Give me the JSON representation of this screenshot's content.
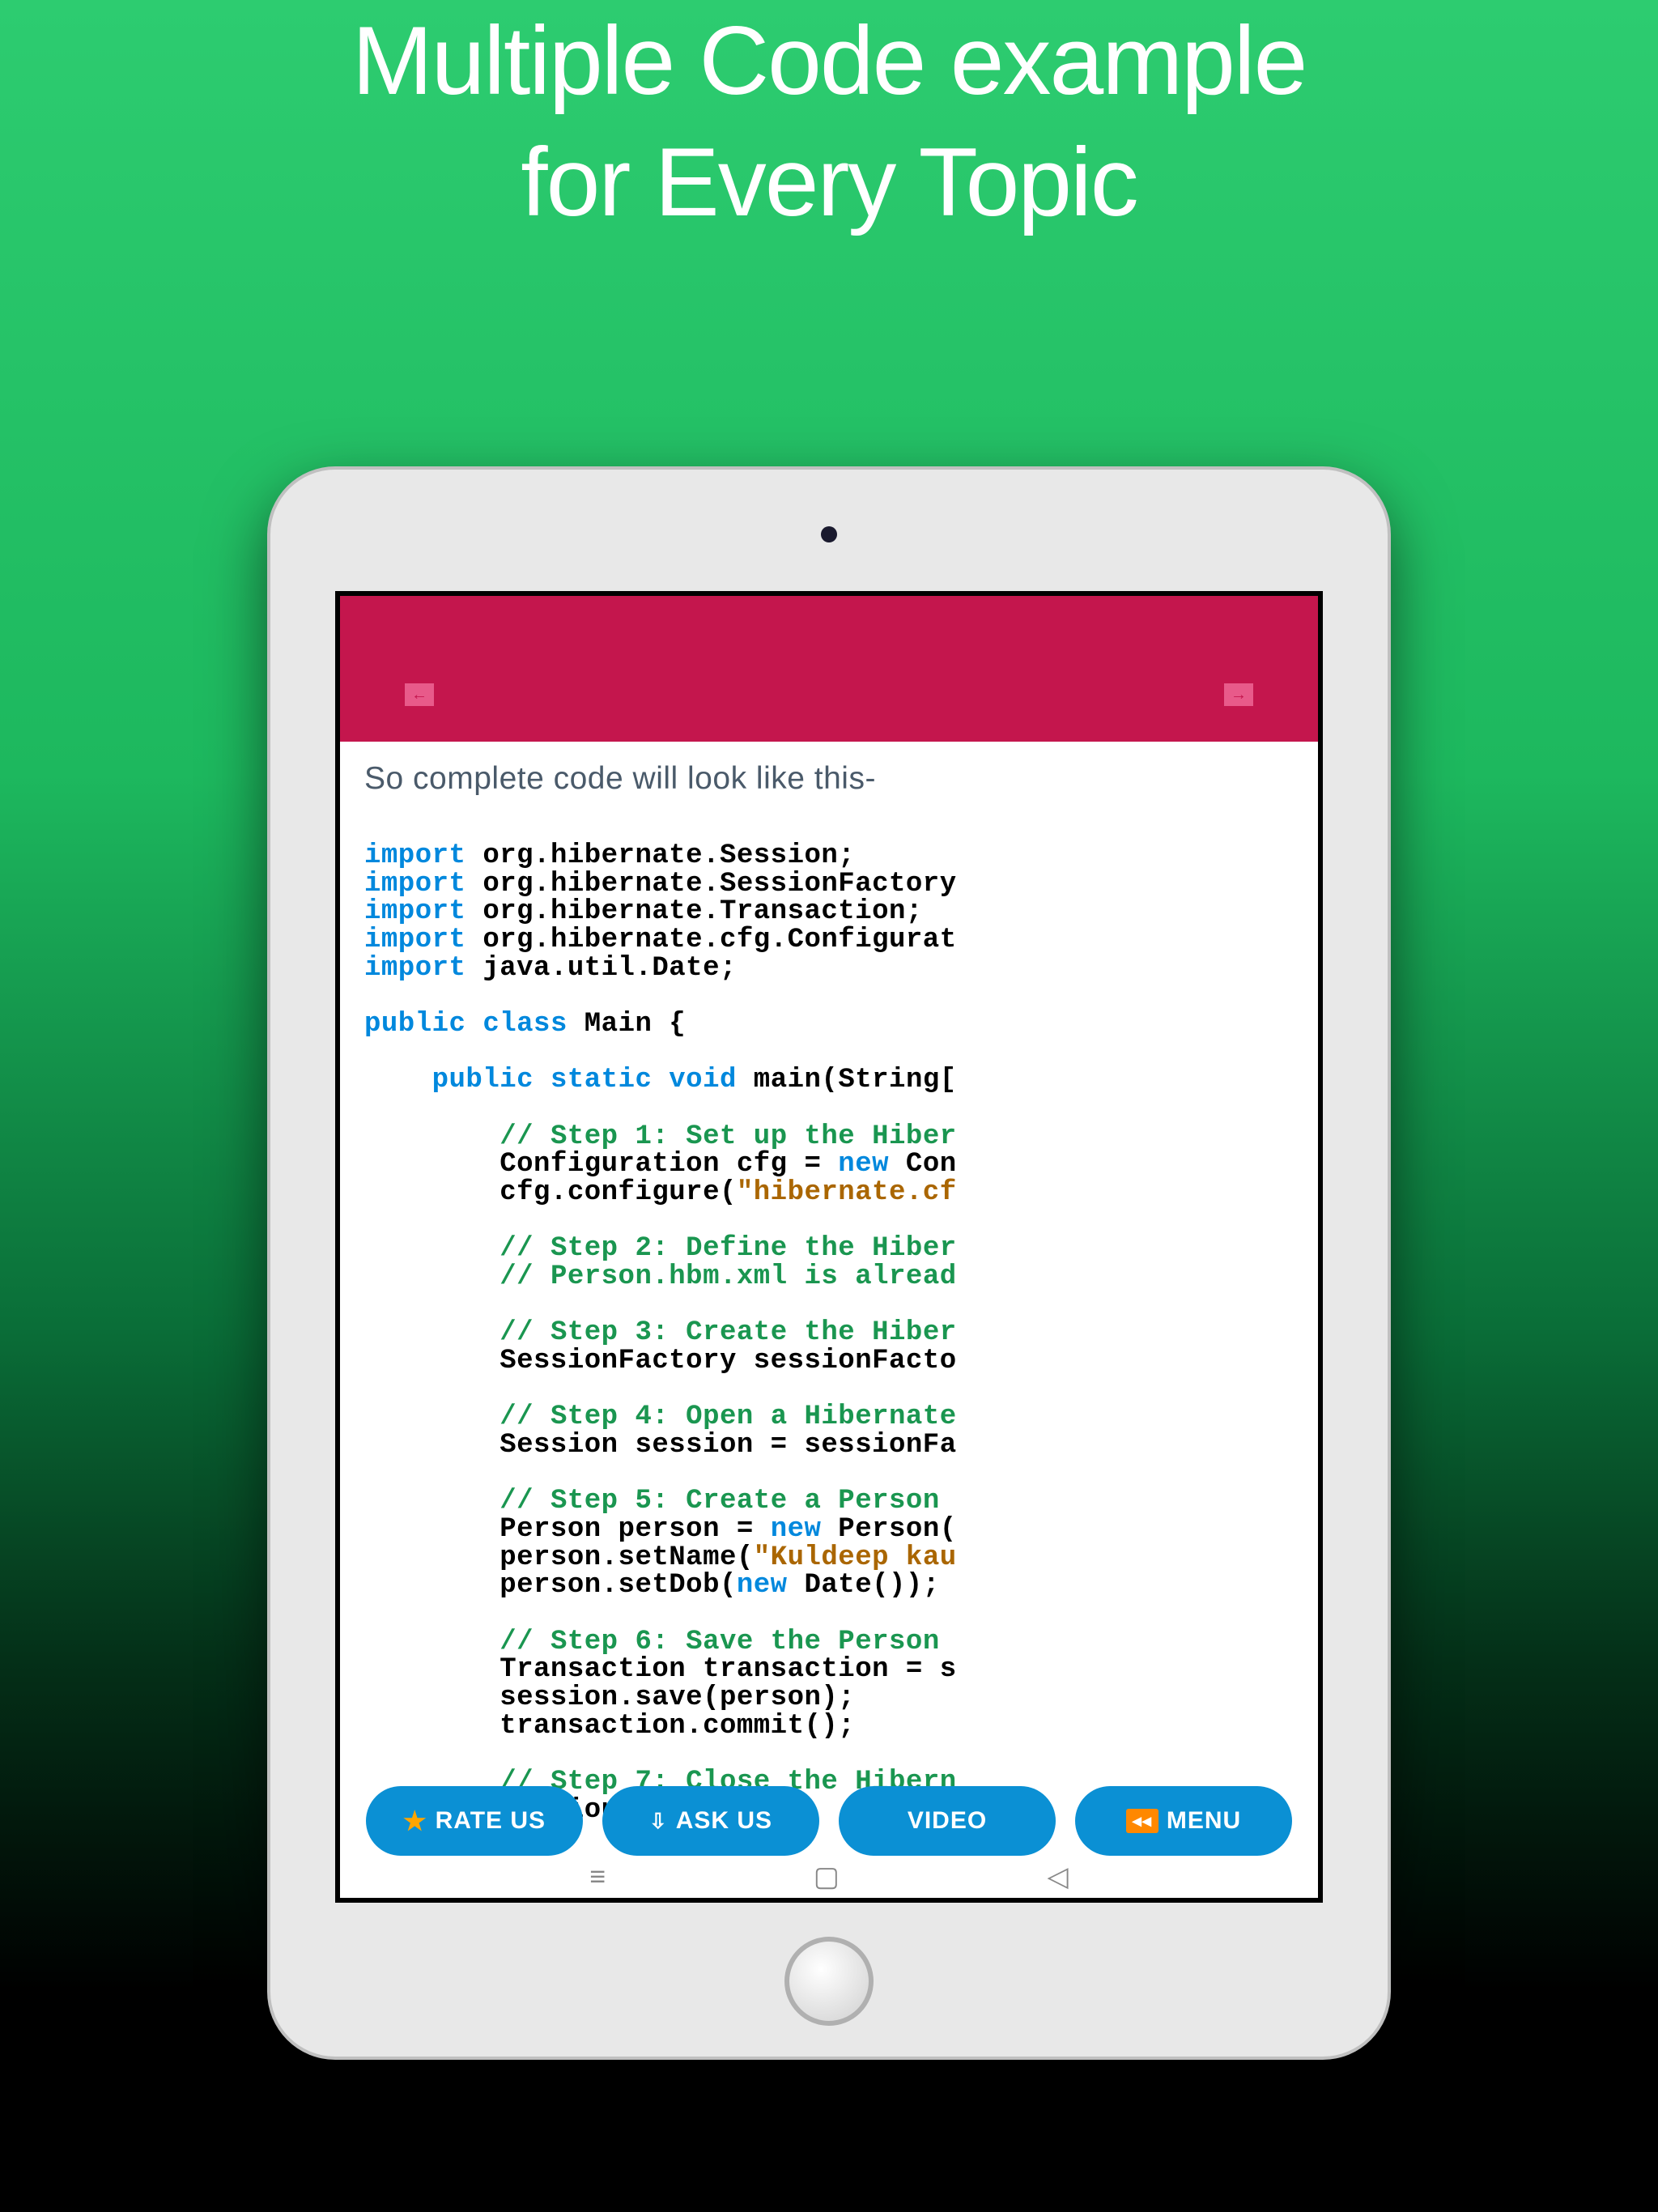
{
  "headline": {
    "line1": "Multiple Code example",
    "line2": "for Every Topic"
  },
  "intro": "So complete code will look like this-",
  "code": {
    "imports": [
      {
        "keyword": "import",
        "rest": " org.hibernate.Session;"
      },
      {
        "keyword": "import",
        "rest": " org.hibernate.SessionFactory"
      },
      {
        "keyword": "import",
        "rest": " org.hibernate.Transaction;"
      },
      {
        "keyword": "import",
        "rest": " org.hibernate.cfg.Configurat"
      },
      {
        "keyword": "import",
        "rest": " java.util.Date;"
      }
    ],
    "class_decl": {
      "kw1": "public",
      "kw2": "class",
      "name": " Main {"
    },
    "main_decl": {
      "kw1": "public",
      "kw2": "static",
      "kw3": "void",
      "rest": " main(String["
    },
    "body": [
      {
        "type": "comment",
        "text": "// Step 1: Set up the Hiber"
      },
      {
        "type": "mixed",
        "pre": "Configuration cfg = ",
        "kw": "new",
        "post": " Con"
      },
      {
        "type": "string_line",
        "pre": "cfg.configure(",
        "str": "\"hibernate.cf"
      },
      {
        "type": "blank"
      },
      {
        "type": "comment",
        "text": "// Step 2: Define the Hiber"
      },
      {
        "type": "comment",
        "text": "// Person.hbm.xml is alread"
      },
      {
        "type": "blank"
      },
      {
        "type": "comment",
        "text": "// Step 3: Create the Hiber"
      },
      {
        "type": "plain",
        "text": "SessionFactory sessionFacto"
      },
      {
        "type": "blank"
      },
      {
        "type": "comment",
        "text": "// Step 4: Open a Hibernate"
      },
      {
        "type": "plain",
        "text": "Session session = sessionFa"
      },
      {
        "type": "blank"
      },
      {
        "type": "comment",
        "text": "// Step 5: Create a Person "
      },
      {
        "type": "mixed",
        "pre": "Person person = ",
        "kw": "new",
        "post": " Person("
      },
      {
        "type": "string_line",
        "pre": "person.setName(",
        "str": "\"Kuldeep kau"
      },
      {
        "type": "mixed",
        "pre": "person.setDob(",
        "kw": "new",
        "post": " Date());"
      },
      {
        "type": "blank"
      },
      {
        "type": "comment",
        "text": "// Step 6: Save the Person "
      },
      {
        "type": "plain",
        "text": "Transaction transaction = s"
      },
      {
        "type": "plain",
        "text": "session.save(person);"
      },
      {
        "type": "plain",
        "text": "transaction.commit();"
      },
      {
        "type": "blank"
      },
      {
        "type": "comment",
        "text": "// Step 7: Close the Hibern"
      },
      {
        "type": "plain",
        "text": "session.close();"
      }
    ]
  },
  "buttons": {
    "rate": "RATE US",
    "ask": "ASK US",
    "video": "VIDEO",
    "menu": "MENU"
  }
}
